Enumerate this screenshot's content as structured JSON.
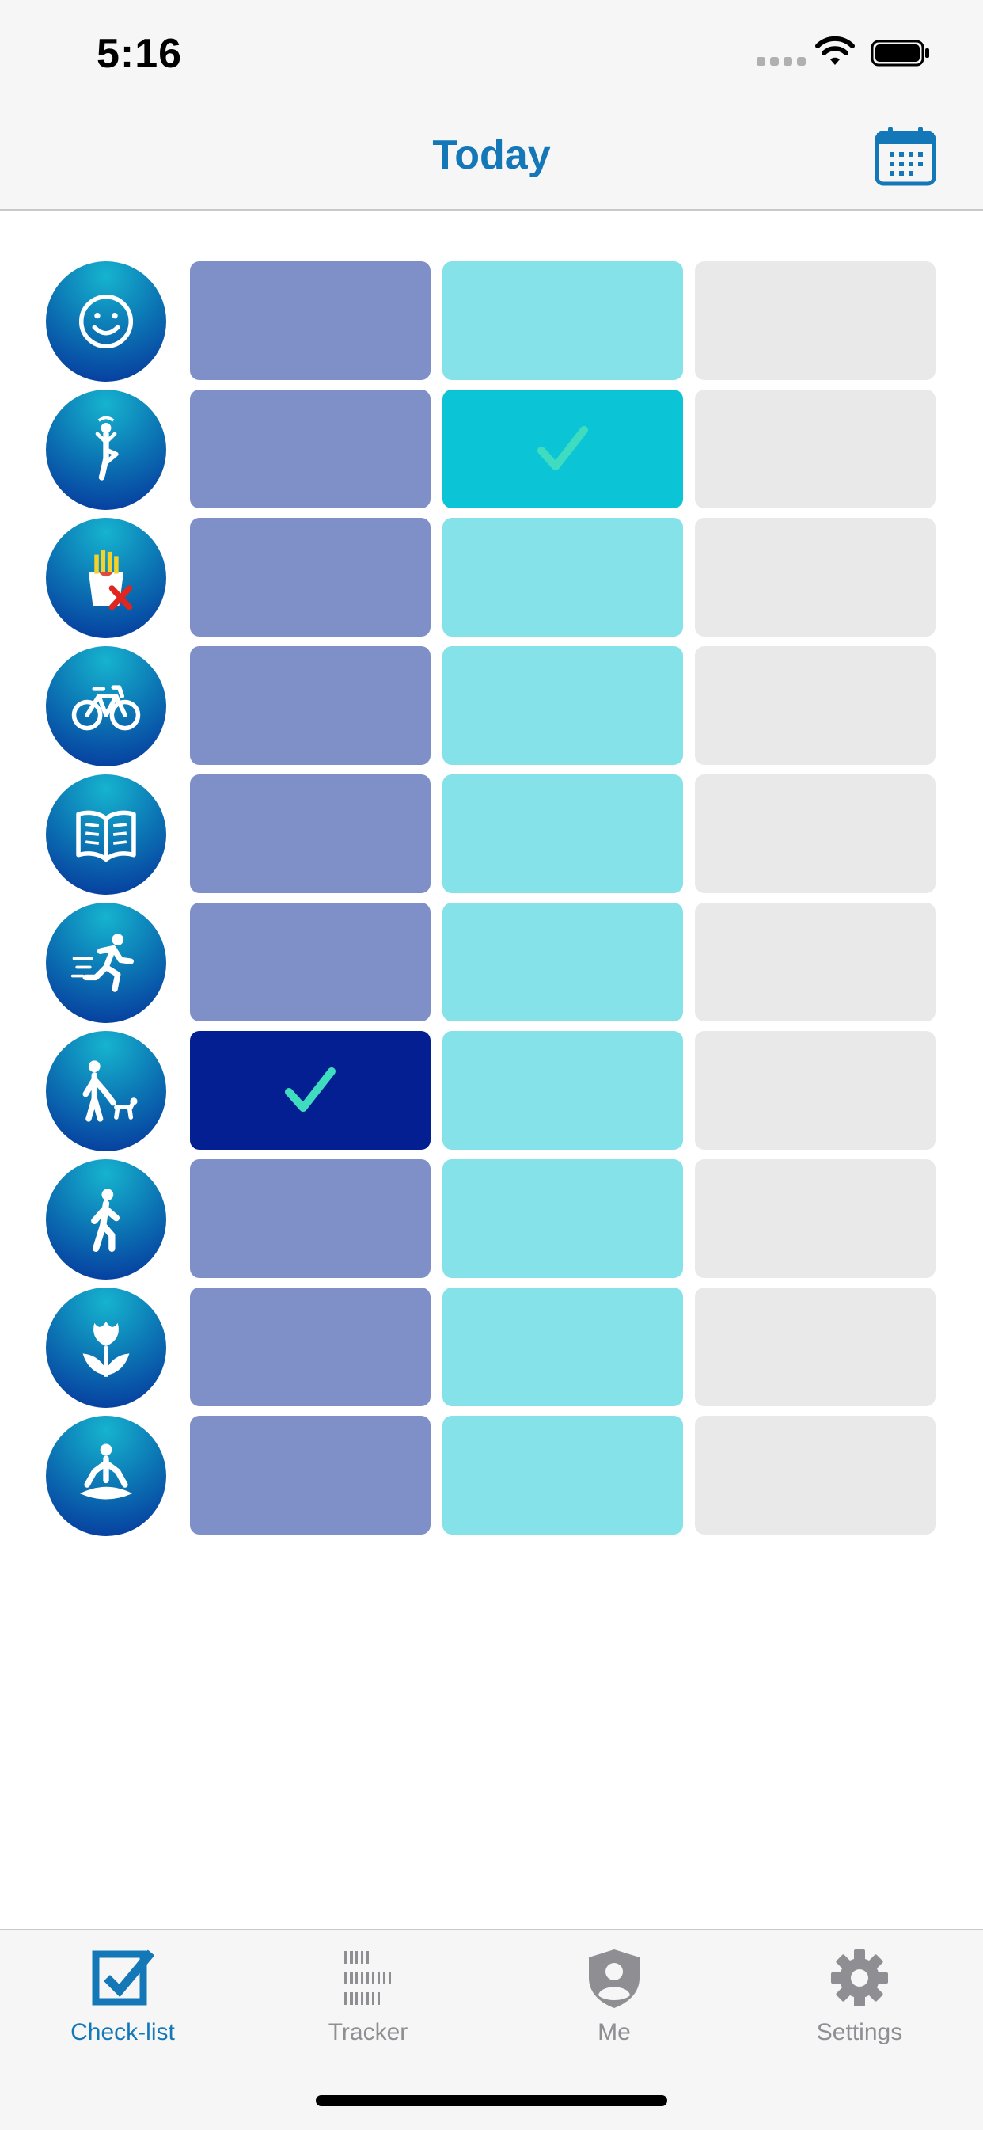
{
  "status_bar": {
    "time": "5:16"
  },
  "nav": {
    "title": "Today",
    "right_icon": "calendar-icon"
  },
  "colors": {
    "accent": "#1478b8",
    "column1": "#7f8fc8",
    "column1_checked": "#031f92",
    "column2": "#85e2e8",
    "column2_checked": "#0bc5d6",
    "column3": "#e9e9e9",
    "check": "#3fdcc0"
  },
  "habits": [
    {
      "icon": "smiley-face-icon",
      "checks": [
        false,
        false,
        false
      ]
    },
    {
      "icon": "yoga-tree-pose-icon",
      "checks": [
        false,
        true,
        false
      ]
    },
    {
      "icon": "no-fries-icon",
      "checks": [
        false,
        false,
        false
      ]
    },
    {
      "icon": "bicycle-icon",
      "checks": [
        false,
        false,
        false
      ]
    },
    {
      "icon": "open-book-icon",
      "checks": [
        false,
        false,
        false
      ]
    },
    {
      "icon": "running-icon",
      "checks": [
        false,
        false,
        false
      ]
    },
    {
      "icon": "dog-walking-icon",
      "checks": [
        true,
        false,
        false
      ]
    },
    {
      "icon": "walking-icon",
      "checks": [
        false,
        false,
        false
      ]
    },
    {
      "icon": "tulip-icon",
      "checks": [
        false,
        false,
        false
      ]
    },
    {
      "icon": "meditation-icon",
      "checks": [
        false,
        false,
        false
      ]
    }
  ],
  "tabs": [
    {
      "label": "Check-list",
      "icon": "checkbox-icon",
      "active": true
    },
    {
      "label": "Tracker",
      "icon": "tracker-bars-icon",
      "active": false
    },
    {
      "label": "Me",
      "icon": "profile-shield-icon",
      "active": false
    },
    {
      "label": "Settings",
      "icon": "gear-icon",
      "active": false
    }
  ]
}
